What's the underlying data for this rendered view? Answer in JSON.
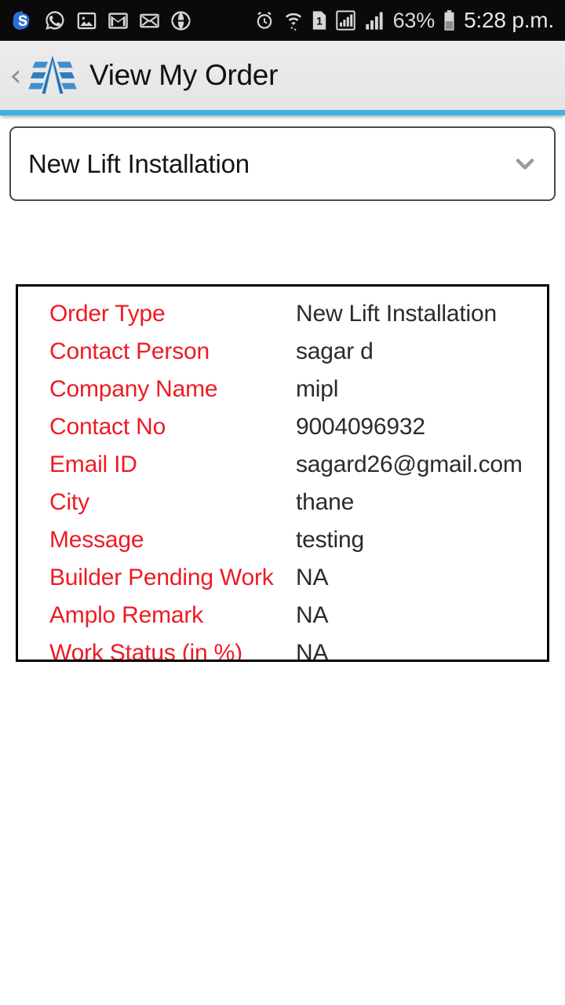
{
  "status_bar": {
    "notification_icons": [
      {
        "name": "skype-icon",
        "glyph": "S"
      },
      {
        "name": "whatsapp-icon",
        "glyph": "whatsapp"
      },
      {
        "name": "gallery-image-icon",
        "glyph": "image"
      },
      {
        "name": "gmail-icon",
        "glyph": "M"
      },
      {
        "name": "email-icon",
        "glyph": "envelope"
      },
      {
        "name": "opera-mini-icon",
        "glyph": "opera"
      }
    ],
    "alarm_icon": "alarm-clock-icon",
    "wifi_icon": "wifi-icon",
    "sim_indicator": "1",
    "signal_icon_1": "signal-bars-boxed-icon",
    "signal_icon_2": "signal-bars-icon",
    "battery_percent": "63%",
    "battery_icon": "battery-icon",
    "clock": "5:28 p.m."
  },
  "header": {
    "back_label": "‹",
    "logo_name": "amplo-lift-logo",
    "title": "View My Order",
    "accent_color": "#3fb2dd",
    "background_color": "#e8e8e8"
  },
  "order_selector": {
    "selected_value": "New Lift Installation",
    "arrow_icon": "chevron-down-icon",
    "options": [
      "New Lift Installation"
    ]
  },
  "order_details": {
    "label_color": "#ec1c24",
    "value_color": "#2b2b2b",
    "rows": [
      {
        "label": "Order Type",
        "value": "New Lift Installation"
      },
      {
        "label": "Contact Person",
        "value": "sagar d"
      },
      {
        "label": "Company Name",
        "value": "mipl"
      },
      {
        "label": "Contact No",
        "value": "9004096932"
      },
      {
        "label": "Email ID",
        "value": "sagard26@gmail.com"
      },
      {
        "label": "City",
        "value": "thane"
      },
      {
        "label": "Message",
        "value": "testing"
      },
      {
        "label": "Builder Pending Work",
        "value": "NA"
      },
      {
        "label": "Amplo Remark",
        "value": "NA"
      },
      {
        "label": "Work Status (in %)",
        "value": "NA"
      }
    ]
  }
}
